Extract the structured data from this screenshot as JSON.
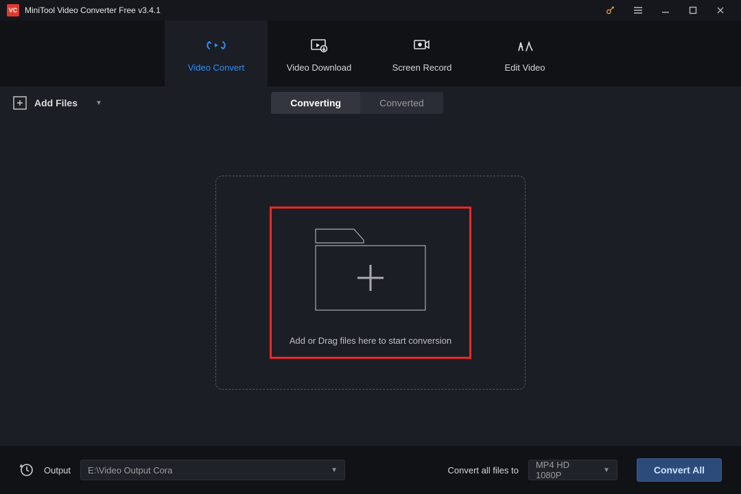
{
  "title": "MiniTool Video Converter Free v3.4.1",
  "tabs": {
    "video_convert": "Video Convert",
    "video_download": "Video Download",
    "screen_record": "Screen Record",
    "edit_video": "Edit Video"
  },
  "toolbar": {
    "add_files": "Add Files"
  },
  "segment": {
    "converting": "Converting",
    "converted": "Converted"
  },
  "dropzone": {
    "text": "Add or Drag files here to start conversion"
  },
  "footer": {
    "output_label": "Output",
    "output_path": "E:\\Video Output Cora",
    "convert_all_label": "Convert all files to",
    "format": "MP4 HD 1080P",
    "convert_button": "Convert All"
  }
}
